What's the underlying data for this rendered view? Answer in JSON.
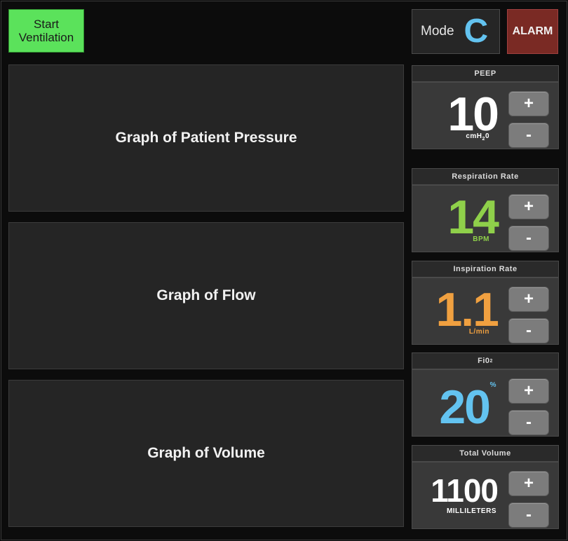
{
  "start_button": {
    "line1": "Start",
    "line2": "Ventilation"
  },
  "mode": {
    "label": "Mode",
    "value": "C",
    "value_color": "#63c3f0"
  },
  "alarm": {
    "label": "ALARM",
    "color": "#7a2a24"
  },
  "graphs": [
    {
      "label": "Graph of Patient Pressure"
    },
    {
      "label": "Graph of Flow"
    },
    {
      "label": "Graph of Volume"
    }
  ],
  "controls": [
    {
      "title": "PEEP",
      "value": "10",
      "unit_main": "cmH",
      "unit_sub": "2",
      "unit_tail": "0",
      "color": "#ffffff",
      "plus": "+",
      "minus": "-"
    },
    {
      "title": "Respiration Rate",
      "value": "14",
      "unit_main": "BPM",
      "color": "#8fd04a",
      "plus": "+",
      "minus": "-"
    },
    {
      "title": "Inspiration Rate",
      "value": "1.1",
      "unit_main": "L/min",
      "color": "#f0a040",
      "plus": "+",
      "minus": "-"
    },
    {
      "title_main": "Fi0",
      "title_sub": "2",
      "value": "20",
      "unit_sup": "%",
      "color": "#63c3f0",
      "plus": "+",
      "minus": "-"
    },
    {
      "title": "Total Volume",
      "value": "1100",
      "unit_main": "MILLILETERS",
      "color": "#ffffff",
      "plus": "+",
      "minus": "-"
    }
  ]
}
